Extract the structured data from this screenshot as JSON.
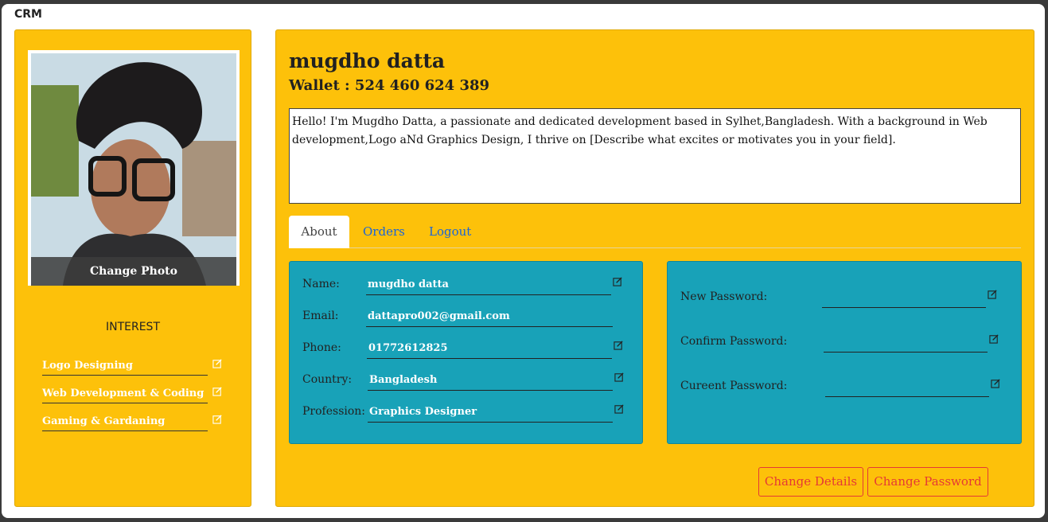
{
  "app": {
    "title": "CRM"
  },
  "profile": {
    "change_photo_label": "Change Photo",
    "interest_title": "INTEREST",
    "interests": [
      {
        "label": "Logo Designing"
      },
      {
        "label": "Web Development & Coding"
      },
      {
        "label": "Gaming & Gardaning"
      }
    ]
  },
  "header": {
    "name": "mugdho datta",
    "wallet": "Wallet : 524 460 624 389",
    "bio": "Hello! I'm Mugdho Datta, a passionate and dedicated development based in Sylhet,Bangladesh. With a background in Web development,Logo aNd Graphics Design, I thrive on [Describe what excites or motivates you in your field]."
  },
  "tabs": [
    {
      "label": "About"
    },
    {
      "label": "Orders"
    },
    {
      "label": "Logout"
    }
  ],
  "about": {
    "name_label": "Name:",
    "name_value": "mugdho datta",
    "email_label": "Email:",
    "email_value": "dattapro002@gmail.com",
    "phone_label": "Phone:",
    "phone_value": "01772612825",
    "country_label": "Country:",
    "country_value": "Bangladesh",
    "profession_label": "Profession:",
    "profession_value": "Graphics Designer"
  },
  "password": {
    "new_label": "New Password:",
    "confirm_label": "Confirm Password:",
    "current_label": "Cureent Password:"
  },
  "actions": {
    "change_details": "Change Details",
    "change_password": "Change Password"
  },
  "colors": {
    "panel": "#fdc10a",
    "card": "#18a2b8",
    "link": "#1a64d8",
    "danger": "#e53935"
  },
  "icons": {
    "edit": "edit-icon",
    "photo": "profile-photo"
  }
}
